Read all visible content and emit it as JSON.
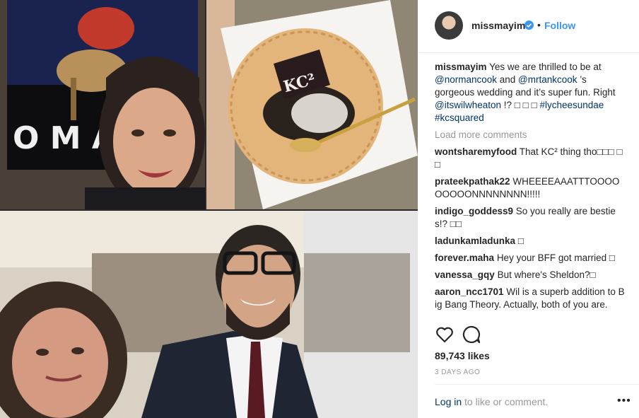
{
  "post": {
    "photo_text": {
      "kc_logo": "KC²",
      "banner_letters": "O M A"
    },
    "header": {
      "username": "missmayim",
      "separator": "•",
      "follow_label": "Follow"
    },
    "caption": {
      "username": "missmayim",
      "t1": "Yes we are thrilled to be at ",
      "m1": "@normancook",
      "t2": " and ",
      "m2": "@mrtankcook",
      "t3": " ’s gorgeous wedding and it’s super fun. Right ",
      "m3": "@itswilwheaton",
      "t4": " !? □ □ □ ",
      "h1": "#lycheesundae",
      "t5": " ",
      "h2": "#kcsquared"
    },
    "load_more": "Load more comments",
    "comments": [
      {
        "user": "wontsharemyfood",
        "text": "That KC² thing tho□□□ □□"
      },
      {
        "user": "prateekpathak22",
        "text": "WHEEEEAAATTTOOOOOOOOONNNNNNNN!!!!!"
      },
      {
        "user": "indigo_goddess9",
        "text": "So you really are besties!? □□"
      },
      {
        "user": "ladunkamladunka",
        "text": "□"
      },
      {
        "user": "forever.maha",
        "text": "Hey your BFF got married □"
      },
      {
        "user": "vanessa_gqy",
        "text": "But where's Sheldon?□"
      },
      {
        "user": "aaron_ncc1701",
        "text": "Wil is a superb addition to Big Bang Theory. Actually, both of you are."
      }
    ],
    "likes": "89,743 likes",
    "time": "3 DAYS AGO",
    "login_link": "Log in",
    "login_rest": " to like or comment.",
    "more_dots": "•••"
  },
  "colors": {
    "link": "#003569",
    "follow": "#3897f0",
    "verified": "#3897f0",
    "muted": "#999999"
  },
  "icons": [
    "heart-icon",
    "comment-icon",
    "verified-badge-icon",
    "more-options-icon"
  ]
}
